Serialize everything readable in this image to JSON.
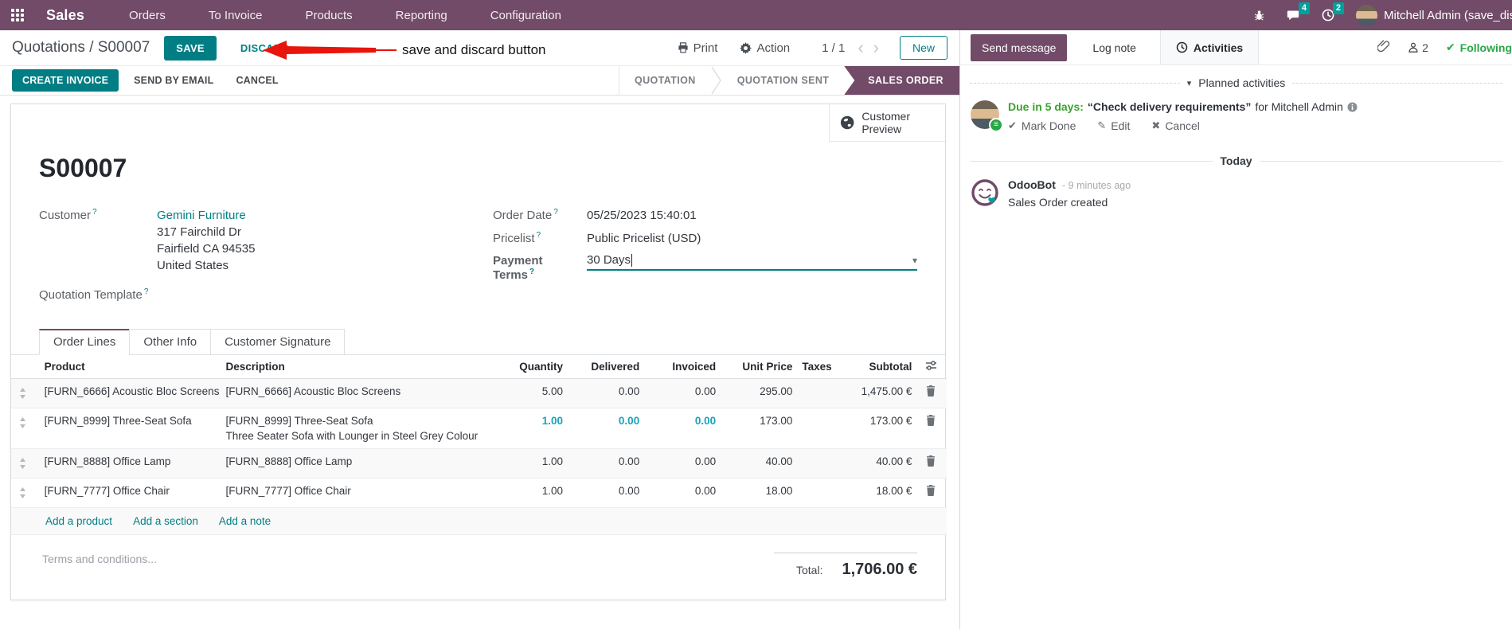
{
  "navbar": {
    "app_name": "Sales",
    "menus": [
      "Orders",
      "To Invoice",
      "Products",
      "Reporting",
      "Configuration"
    ],
    "message_badge": "4",
    "activity_badge": "2",
    "user_name": "Mitchell Admin (save_discar"
  },
  "control_panel": {
    "breadcrumb_parent": "Quotations",
    "breadcrumb_sep": "/",
    "breadcrumb_current": "S00007",
    "save_label": "SAVE",
    "discard_label": "DISCARD",
    "print_label": "Print",
    "action_label": "Action",
    "pager": "1 / 1",
    "new_label": "New"
  },
  "annotation": {
    "text": "save and discard button",
    "arrow_color": "#e8150c"
  },
  "statusbar": {
    "buttons": [
      "CREATE INVOICE",
      "SEND BY EMAIL",
      "CANCEL"
    ],
    "states": [
      "QUOTATION",
      "QUOTATION SENT",
      "SALES ORDER"
    ],
    "active_state": "SALES ORDER"
  },
  "form": {
    "customer_preview": "Customer Preview",
    "title": "S00007",
    "help_marker": "?",
    "fields": {
      "customer_label": "Customer",
      "customer_value": "Gemini Furniture",
      "address": [
        "317 Fairchild Dr",
        "Fairfield CA 94535",
        "United States"
      ],
      "quotation_template_label": "Quotation Template",
      "order_date_label": "Order Date",
      "order_date_value": "05/25/2023 15:40:01",
      "pricelist_label": "Pricelist",
      "pricelist_value": "Public Pricelist (USD)",
      "payment_terms_label": "Payment Terms",
      "payment_terms_value": "30 Days"
    },
    "tabs": [
      "Order Lines",
      "Other Info",
      "Customer Signature"
    ],
    "active_tab": "Order Lines",
    "order_lines": {
      "columns": [
        "Product",
        "Description",
        "Quantity",
        "Delivered",
        "Invoiced",
        "Unit Price",
        "Taxes",
        "Subtotal"
      ],
      "rows": [
        {
          "product": "[FURN_6666] Acoustic Bloc Screens",
          "description": "[FURN_6666] Acoustic Bloc Screens",
          "description2": "",
          "quantity": "5.00",
          "delivered": "0.00",
          "invoiced": "0.00",
          "unit_price": "295.00",
          "taxes": "",
          "subtotal": "1,475.00 €",
          "highlight": false
        },
        {
          "product": "[FURN_8999] Three-Seat Sofa",
          "description": "[FURN_8999] Three-Seat Sofa",
          "description2": "Three Seater Sofa with Lounger in Steel Grey Colour",
          "quantity": "1.00",
          "delivered": "0.00",
          "invoiced": "0.00",
          "unit_price": "173.00",
          "taxes": "",
          "subtotal": "173.00 €",
          "highlight": true
        },
        {
          "product": "[FURN_8888] Office Lamp",
          "description": "[FURN_8888] Office Lamp",
          "description2": "",
          "quantity": "1.00",
          "delivered": "0.00",
          "invoiced": "0.00",
          "unit_price": "40.00",
          "taxes": "",
          "subtotal": "40.00 €",
          "highlight": false
        },
        {
          "product": "[FURN_7777] Office Chair",
          "description": "[FURN_7777] Office Chair",
          "description2": "",
          "quantity": "1.00",
          "delivered": "0.00",
          "invoiced": "0.00",
          "unit_price": "18.00",
          "taxes": "",
          "subtotal": "18.00 €",
          "highlight": false
        }
      ],
      "footer_links": [
        "Add a product",
        "Add a section",
        "Add a note"
      ]
    },
    "terms_placeholder": "Terms and conditions...",
    "total_label": "Total:",
    "total_value": "1,706.00 €"
  },
  "chatter": {
    "send_message": "Send message",
    "log_note": "Log note",
    "activities": "Activities",
    "follower_count": "2",
    "following": "Following",
    "planned_activities": "Planned activities",
    "activity": {
      "due": "Due in 5 days:",
      "summary": "“Check delivery requirements”",
      "for_text": "for Mitchell Admin",
      "actions": [
        {
          "glyph": "✔",
          "label": "Mark Done",
          "icon": "check-icon"
        },
        {
          "glyph": "✎",
          "label": "Edit",
          "icon": "pencil-icon"
        },
        {
          "glyph": "✖",
          "label": "Cancel",
          "icon": "x-icon"
        }
      ]
    },
    "today": "Today",
    "message": {
      "author": "OdooBot",
      "time": "- 9 minutes ago",
      "body": "Sales Order created"
    }
  },
  "colors": {
    "brand_purple": "#714B67",
    "primary_teal": "#017E84",
    "badge_teal": "#00A09D",
    "highlight_blue": "#17a2b8",
    "following_green": "#28a745",
    "due_green": "#3aa32e",
    "annotation_red": "#e8150c"
  }
}
